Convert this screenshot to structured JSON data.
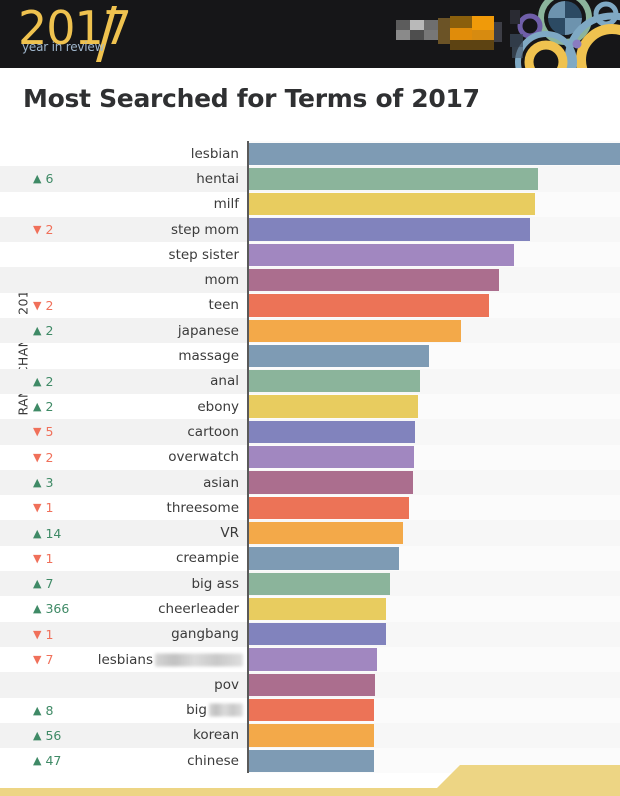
{
  "header": {
    "logo_year": "2017",
    "logo_subtitle": "year in review",
    "logo_color": "#efc24f",
    "logo_subtitle_color": "#9fb6cc",
    "background_color": "#161618",
    "censored_block": "[redacted]"
  },
  "title": "Most Searched for Terms of 2017",
  "chart_data": {
    "type": "bar",
    "orientation": "horizontal",
    "title": "Most Searched for Terms of 2017",
    "xlabel": "",
    "ylabel": "RANK CHANGE 2017",
    "grid": false,
    "legend": null,
    "axis_range": [
      0,
      100
    ],
    "value_unit": "relative search volume (% of top term)",
    "categories": [
      "lesbian",
      "hentai",
      "milf",
      "step mom",
      "step sister",
      "mom",
      "teen",
      "japanese",
      "massage",
      "anal",
      "ebony",
      "cartoon",
      "overwatch",
      "asian",
      "threesome",
      "VR",
      "creampie",
      "big ass",
      "cheerleader",
      "gangbang",
      "lesbians",
      "pov",
      "big",
      "korean",
      "chinese"
    ],
    "values": [
      100,
      77.8,
      77.2,
      75.7,
      71.4,
      67.5,
      64.7,
      57.1,
      48.6,
      46.2,
      45.6,
      44.7,
      44.4,
      44.1,
      43.2,
      41.6,
      40.4,
      38.0,
      36.8,
      36.8,
      34.6,
      34.0,
      33.7,
      33.7,
      33.7
    ],
    "rank_changes": [
      {
        "dir": "none",
        "value": ""
      },
      {
        "dir": "up",
        "value": "6"
      },
      {
        "dir": "none",
        "value": ""
      },
      {
        "dir": "down",
        "value": "2"
      },
      {
        "dir": "none",
        "value": ""
      },
      {
        "dir": "none",
        "value": ""
      },
      {
        "dir": "down",
        "value": "2"
      },
      {
        "dir": "up",
        "value": "2"
      },
      {
        "dir": "none",
        "value": ""
      },
      {
        "dir": "up",
        "value": "2"
      },
      {
        "dir": "up",
        "value": "2"
      },
      {
        "dir": "down",
        "value": "5"
      },
      {
        "dir": "down",
        "value": "2"
      },
      {
        "dir": "up",
        "value": "3"
      },
      {
        "dir": "down",
        "value": "1"
      },
      {
        "dir": "up",
        "value": "14"
      },
      {
        "dir": "down",
        "value": "1"
      },
      {
        "dir": "up",
        "value": "7"
      },
      {
        "dir": "up",
        "value": "366"
      },
      {
        "dir": "down",
        "value": "1"
      },
      {
        "dir": "down",
        "value": "7"
      },
      {
        "dir": "none",
        "value": ""
      },
      {
        "dir": "up",
        "value": "8"
      },
      {
        "dir": "up",
        "value": "56"
      },
      {
        "dir": "up",
        "value": "47"
      }
    ],
    "censored_labels": [
      {
        "index": 20,
        "width": 88
      },
      {
        "index": 22,
        "width": 34
      }
    ],
    "palette": [
      "#7e9bb4",
      "#8bb49b",
      "#e8cc5f",
      "#8183bd",
      "#a187c0",
      "#ab6e8e",
      "#ec7357",
      "#f3a949"
    ],
    "bar_colors": [
      "#7e9bb4",
      "#8bb49b",
      "#e8cc5f",
      "#8183bd",
      "#a187c0",
      "#ab6e8e",
      "#ec7357",
      "#f3a949",
      "#7e9bb4",
      "#8bb49b",
      "#e8cc5f",
      "#8183bd",
      "#a187c0",
      "#ab6e8e",
      "#ec7357",
      "#f3a949",
      "#7e9bb4",
      "#8bb49b",
      "#e8cc5f",
      "#8183bd",
      "#a187c0",
      "#ab6e8e",
      "#ec7357",
      "#f3a949",
      "#7e9bb4"
    ]
  },
  "rank_change_axis_label": "RANK CHANGE 2017",
  "colors": {
    "up_arrow": "#3f8a66",
    "down_arrow": "#f0705a",
    "row_stripe": "#f2f2f2",
    "track": "#f7f7f7",
    "axis_line": "#5a5a5a",
    "footer_accent": "#edd584",
    "text": "#3b3b3b"
  },
  "footer": {
    "accent_color": "#edd584"
  }
}
